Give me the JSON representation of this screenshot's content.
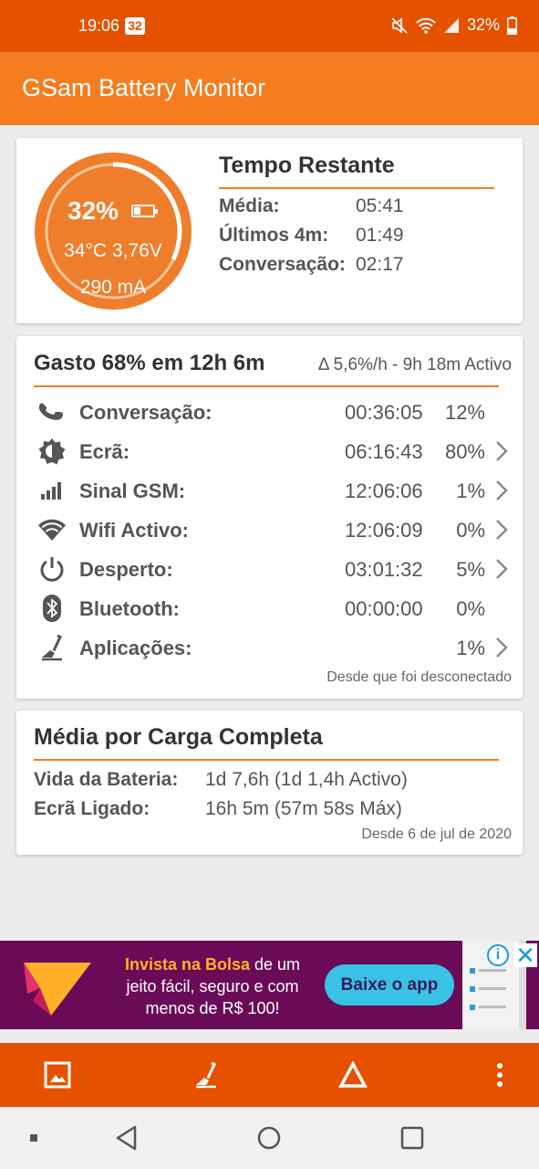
{
  "status_bar": {
    "time": "19:06",
    "notification_badge": "32",
    "battery_percent": "32%",
    "icons": [
      "mute-icon",
      "wifi-icon",
      "signal-icon",
      "battery-icon"
    ]
  },
  "app": {
    "title": "GSam Battery Monitor",
    "accent_color": "#f57c1f",
    "dark_accent_color": "#e65100"
  },
  "gauge": {
    "percent": "32%",
    "level": 0.32,
    "temp_voltage": "34°C  3,76V",
    "current": "290 mA"
  },
  "time_remaining": {
    "title": "Tempo Restante",
    "rows": [
      {
        "label": "Média:",
        "value": "05:41"
      },
      {
        "label": "Últimos 4m:",
        "value": "01:49"
      },
      {
        "label": "Conversação:",
        "value": "02:17"
      }
    ]
  },
  "usage": {
    "title": "Gasto 68% em 12h 6m",
    "subtitle": "Δ 5,6%/h - 9h 18m Activo",
    "rows": [
      {
        "icon": "phone-icon",
        "label": "Conversação:",
        "time": "00:36:05",
        "percent": "12%",
        "has_chevron": false
      },
      {
        "icon": "screen-brightness-icon",
        "label": "Ecrã:",
        "time": "06:16:43",
        "percent": "80%",
        "has_chevron": true
      },
      {
        "icon": "signal-bars-icon",
        "label": "Sinal GSM:",
        "time": "12:06:06",
        "percent": "1%",
        "has_chevron": true
      },
      {
        "icon": "wifi-icon",
        "label": "Wifi Activo:",
        "time": "12:06:09",
        "percent": "0%",
        "has_chevron": true
      },
      {
        "icon": "power-icon",
        "label": "Desperto:",
        "time": "03:01:32",
        "percent": "5%",
        "has_chevron": true
      },
      {
        "icon": "bluetooth-icon",
        "label": "Bluetooth:",
        "time": "00:00:00",
        "percent": "0%",
        "has_chevron": false
      },
      {
        "icon": "apps-icon",
        "label": "Aplicações:",
        "time": "",
        "percent": "1%",
        "has_chevron": true
      }
    ],
    "footer": "Desde que foi desconectado"
  },
  "full_charge": {
    "title": "Média por Carga Completa",
    "rows": [
      {
        "label": "Vida da Bateria:",
        "value": "1d 7,6h (1d 1,4h Activo)"
      },
      {
        "label": "Ecrã Ligado:",
        "value": "16h 5m (57m 58s Máx)"
      }
    ],
    "footer": "Desde 6 de jul de 2020"
  },
  "ad": {
    "line1_highlight": "Invista na Bolsa",
    "line1_rest": " de um",
    "line2": "jeito fácil, seguro e com",
    "line3": "menos de R$ 100!",
    "button": "Baixe o app",
    "info_glyph": "i",
    "close_glyph": "✕"
  },
  "bottom_bar": {
    "buttons": [
      "image-icon",
      "apps-icon",
      "delta-icon",
      "more-vertical-icon"
    ]
  },
  "nav_bar": {
    "buttons": [
      "recents-dot-icon",
      "back-icon",
      "home-icon",
      "overview-icon"
    ]
  }
}
